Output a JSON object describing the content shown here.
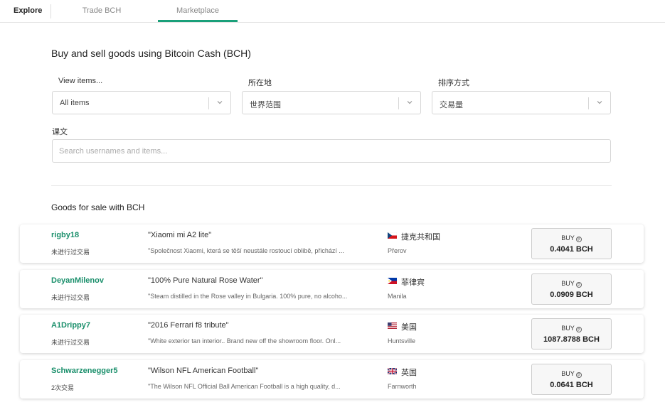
{
  "nav": {
    "explore": "Explore",
    "tabs": [
      {
        "label": "Trade BCH"
      },
      {
        "label": "Marketplace"
      }
    ],
    "accent": "#1aa07a"
  },
  "main": {
    "heading": "Buy and sell goods using Bitcoin Cash (BCH)",
    "filters": {
      "view_label": "View items...",
      "view_value": "All items",
      "location_label": "所在地",
      "location_value": "世界范围",
      "sort_label": "排序方式",
      "sort_value": "交易量",
      "text_label": "课文",
      "search_placeholder": "Search usernames and items..."
    },
    "section_title": "Goods for sale with BCH",
    "listings": [
      {
        "user": "rigby18",
        "trades": "未进行过交易",
        "title": "\"Xiaomi mi A2 lite\"",
        "desc": "\"Společnost Xiaomi, která se těší neustále rostoucí oblibě, přichází ...",
        "country": "捷克共和国",
        "city": "Přerov",
        "buy_label": "BUY",
        "price": "0.4041 BCH",
        "flag": "czech-flag"
      },
      {
        "user": "DeyanMilenov",
        "trades": "未进行过交易",
        "title": "\"100% Pure Natural Rose Water\"",
        "desc": "\"Steam distilled in the Rose valley in Bulgaria. 100% pure, no alcoho...",
        "country": "菲律宾",
        "city": "Manila",
        "buy_label": "BUY",
        "price": "0.0909 BCH",
        "flag": "philippines-flag"
      },
      {
        "user": "A1Drippy7",
        "trades": "未进行过交易",
        "title": "\"2016 Ferrari f8 tribute\"",
        "desc": "\"White exterior tan interior.. Brand new off the showroom floor. Onl...",
        "country": "美国",
        "city": "Huntsville",
        "buy_label": "BUY",
        "price": "1087.8788 BCH",
        "flag": "usa-flag"
      },
      {
        "user": "Schwarzenegger5",
        "trades": "2次交易",
        "title": "\"Wilson NFL American Football\"",
        "desc": "\"The Wilson NFL Official Ball American Football is a high quality, d...",
        "country": "英国",
        "city": "Farnworth",
        "buy_label": "BUY",
        "price": "0.0641 BCH",
        "flag": "uk-flag"
      }
    ]
  }
}
